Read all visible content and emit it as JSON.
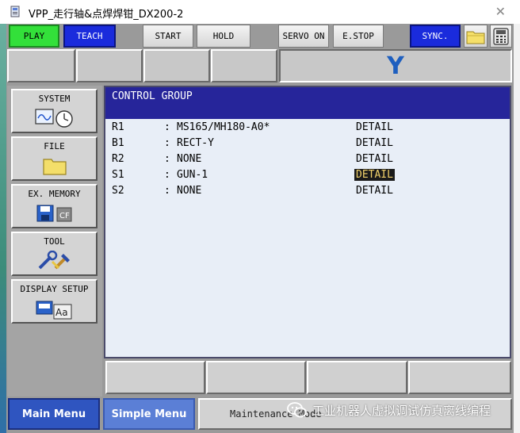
{
  "window": {
    "title": "VPP_走行轴&点焊焊钳_DX200-2",
    "close_glyph": "✕"
  },
  "toolbar": {
    "play": "PLAY",
    "teach": "TEACH",
    "start": "START",
    "hold": "HOLD",
    "servo_on": "SERVO ON",
    "estop": "E.STOP",
    "sync": "SYNC.",
    "folder_icon": "folder-icon",
    "pendant_icon": "pendant-icon"
  },
  "axis_display": {
    "letter": "Y"
  },
  "menu": [
    {
      "label": "SYSTEM",
      "icon": "system-icon"
    },
    {
      "label": "FILE",
      "icon": "folder-icon"
    },
    {
      "label": "EX. MEMORY",
      "icon": "memory-icon"
    },
    {
      "label": "TOOL",
      "icon": "tool-icon"
    },
    {
      "label": "DISPLAY SETUP",
      "icon": "display-setup-icon"
    }
  ],
  "content": {
    "header": "CONTROL GROUP",
    "rows": [
      {
        "axis": "R1",
        "colon": ":",
        "value": "MS165/MH180-A0*",
        "detail": "DETAIL"
      },
      {
        "axis": "B1",
        "colon": ":",
        "value": "RECT-Y",
        "detail": "DETAIL"
      },
      {
        "axis": "R2",
        "colon": ":",
        "value": "NONE",
        "detail": "DETAIL"
      },
      {
        "axis": "S1",
        "colon": ":",
        "value": "GUN-1",
        "detail": "DETAIL"
      },
      {
        "axis": "S2",
        "colon": ":",
        "value": "NONE",
        "detail": "DETAIL"
      }
    ],
    "selected_row": 3
  },
  "bottom_tabs": {
    "main_menu": "Main Menu",
    "simple_menu": "Simple Menu",
    "maintenance": "Maintenance Mode"
  },
  "watermark": {
    "text": "工业机器人虚拟调试仿真离线编程"
  },
  "colors": {
    "play_bg": "#33e03a",
    "teach_bg": "#1a2bdc",
    "sync_bg": "#1a2bdc",
    "header_bg": "#26259a",
    "selected_bg": "#1a1a1a",
    "selected_fg": "#f3d36b",
    "axis_letter": "#1e5fbf"
  }
}
